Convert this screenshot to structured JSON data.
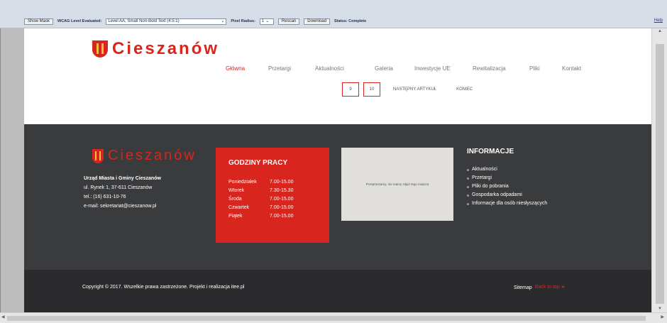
{
  "toolbar": {
    "show_mask": "Show Mask",
    "wcag_label": "WCAG Level Evaluated:",
    "wcag_value": "Level AA, Small Non-Bold Text (4.5:1)",
    "pixel_label": "Pixel Radius:",
    "pixel_value": "1",
    "rescan": "Rescan",
    "download": "Download",
    "status": "Status: Complete",
    "help": "Help"
  },
  "header": {
    "logo_text": "Cieszanów",
    "nav": [
      "Główna",
      "Przetargi",
      "Aktualności",
      "Galeria",
      "Inwestycje UE",
      "Rewitalizacja",
      "Pliki",
      "Kontakt"
    ],
    "active_nav": "Główna",
    "pager": {
      "pages": [
        "9",
        "10"
      ],
      "next": "NASTĘPNY ARTYKUŁ",
      "end": "KONIEC"
    }
  },
  "footer": {
    "logo_text": "Cieszanów",
    "address": {
      "name": "Urząd Miasta i Gminy Cieszanów",
      "street": "ul. Rynek 1, 37-611 Cieszanów",
      "phone": "tel.: (16) 631-10-76",
      "email": "e-mail: sekretariat@cieszanow.pl"
    },
    "hours": {
      "title": "GODZINY PRACY",
      "rows": [
        {
          "day": "Poniedziałek",
          "time": "7.00-15.00"
        },
        {
          "day": "Wtorek",
          "time": "7.30-15.30"
        },
        {
          "day": "Środa",
          "time": "7.00-15.00"
        },
        {
          "day": "Czwartek",
          "time": "7.00-15.00"
        },
        {
          "day": "Piątek",
          "time": "7.00-15.00"
        }
      ]
    },
    "map_text": "Przepraszamy, nie mamy zdjęć tego miejsca",
    "info": {
      "title": "INFORMACJE",
      "items": [
        "Aktualności",
        "Przetargi",
        "Pliki do pobrania",
        "Gospodarka odpadami",
        "Informacje dla osób niesłyszących"
      ]
    }
  },
  "copyright": {
    "text": "Copyright © 2017. Wszelkie prawa zastrzeżone.   Projekt i realizacja itee.pl",
    "sitemap": "Sitemap",
    "back_to_top": "Back to top",
    "back_arrow": "⏶"
  },
  "colors": {
    "accent": "#d8251d",
    "footer_bg": "#3a3b3d",
    "copyright_bg": "#2b2b2d"
  }
}
